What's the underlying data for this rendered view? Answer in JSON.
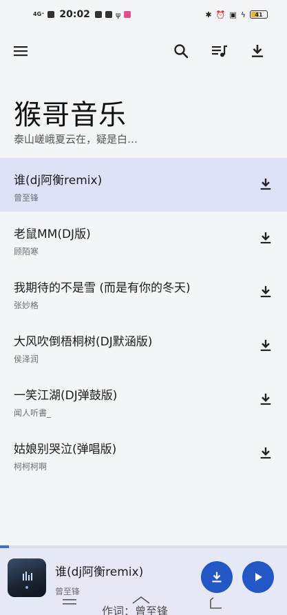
{
  "status_bar": {
    "network": "4G⁺",
    "time": "20:02",
    "battery": "41"
  },
  "toolbar": {
    "menu_icon": "hamburger-menu-icon",
    "search_icon": "search-icon",
    "queue_icon": "playlist-music-icon",
    "download_all_icon": "download-icon"
  },
  "header": {
    "title": "猴哥音乐",
    "subtitle": "泰山嵯峨夏云在，疑是白…"
  },
  "songs": [
    {
      "title": "谁(dj阿衡remix)",
      "artist": "曾至锋",
      "active": true
    },
    {
      "title": "老鼠MM(DJ版)",
      "artist": "顾陌寒",
      "active": false
    },
    {
      "title": "我期待的不是雪 (而是有你的冬天)",
      "artist": "张妙格",
      "active": false
    },
    {
      "title": "大风吹倒梧桐树(DJ默涵版)",
      "artist": "侯泽润",
      "active": false
    },
    {
      "title": "一笑江湖(DJ弹鼓版)",
      "artist": "闻人听書_",
      "active": false
    },
    {
      "title": "姑娘别哭泣(弹唱版)",
      "artist": "柯柯柯啊",
      "active": false
    }
  ],
  "player": {
    "title": "谁(dj阿衡remix)",
    "artist": "曾至锋",
    "progress": 0.03
  },
  "nav_bar": {
    "overlay_text": "作词：曾至锋"
  },
  "colors": {
    "accent": "#2257c5",
    "active_row": "#dde2f7",
    "background": "#f4f5f9"
  }
}
